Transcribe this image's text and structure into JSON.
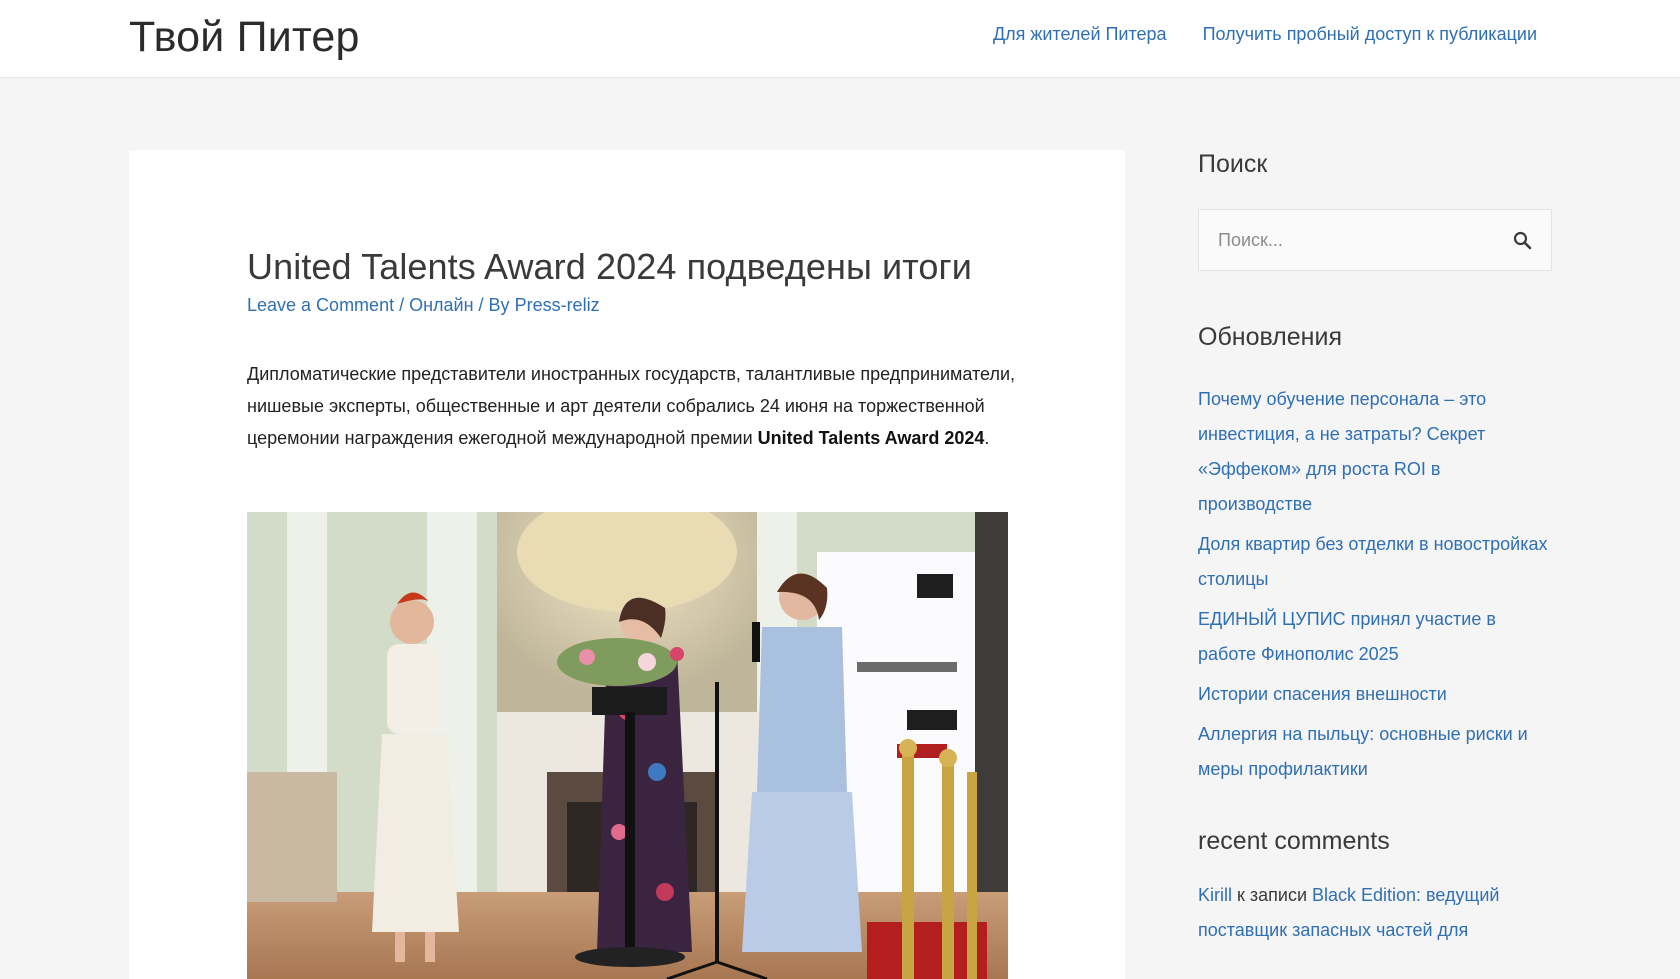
{
  "site": {
    "title": "Твой Питер",
    "nav": [
      {
        "label": "Для жителей Питера"
      },
      {
        "label": "Получить пробный доступ к публикации"
      }
    ]
  },
  "article": {
    "title": "United Talents Award 2024 подведены итоги",
    "meta": {
      "comments_link": "Leave a Comment",
      "sep1": " / ",
      "category": "Онлайн",
      "sep2": " / By ",
      "author": "Press-reliz"
    },
    "paragraph": "Дипломатические представители иностранных государств, талантливые предприниматели, нишевые эксперты, общественные и арт деятели собрались 24 июня на торжественной церемонии награждения ежегодной международной премии ",
    "paragraph_bold": "United Talents Award 2024",
    "paragraph_end": "."
  },
  "sidebar": {
    "search_title": "Поиск",
    "search_placeholder": "Поиск...",
    "updates_title": "Обновления",
    "updates": [
      "Почему обучение персонала – это инвестиция, а не затраты? Секрет «Эффеком» для роста ROI в производстве",
      "Доля квартир без отделки в новостройках столицы",
      "ЕДИНЫЙ ЦУПИС принял участие в работе Финополис 2025",
      "Истории спасения внешности",
      "Аллергия на пыльцу: основные риски и меры профилактики"
    ],
    "comments_title": "recent comments",
    "comment": {
      "author": "Kirill",
      "connector": " к записи ",
      "post": "Black Edition: ведущий поставщик запасных частей для"
    }
  }
}
